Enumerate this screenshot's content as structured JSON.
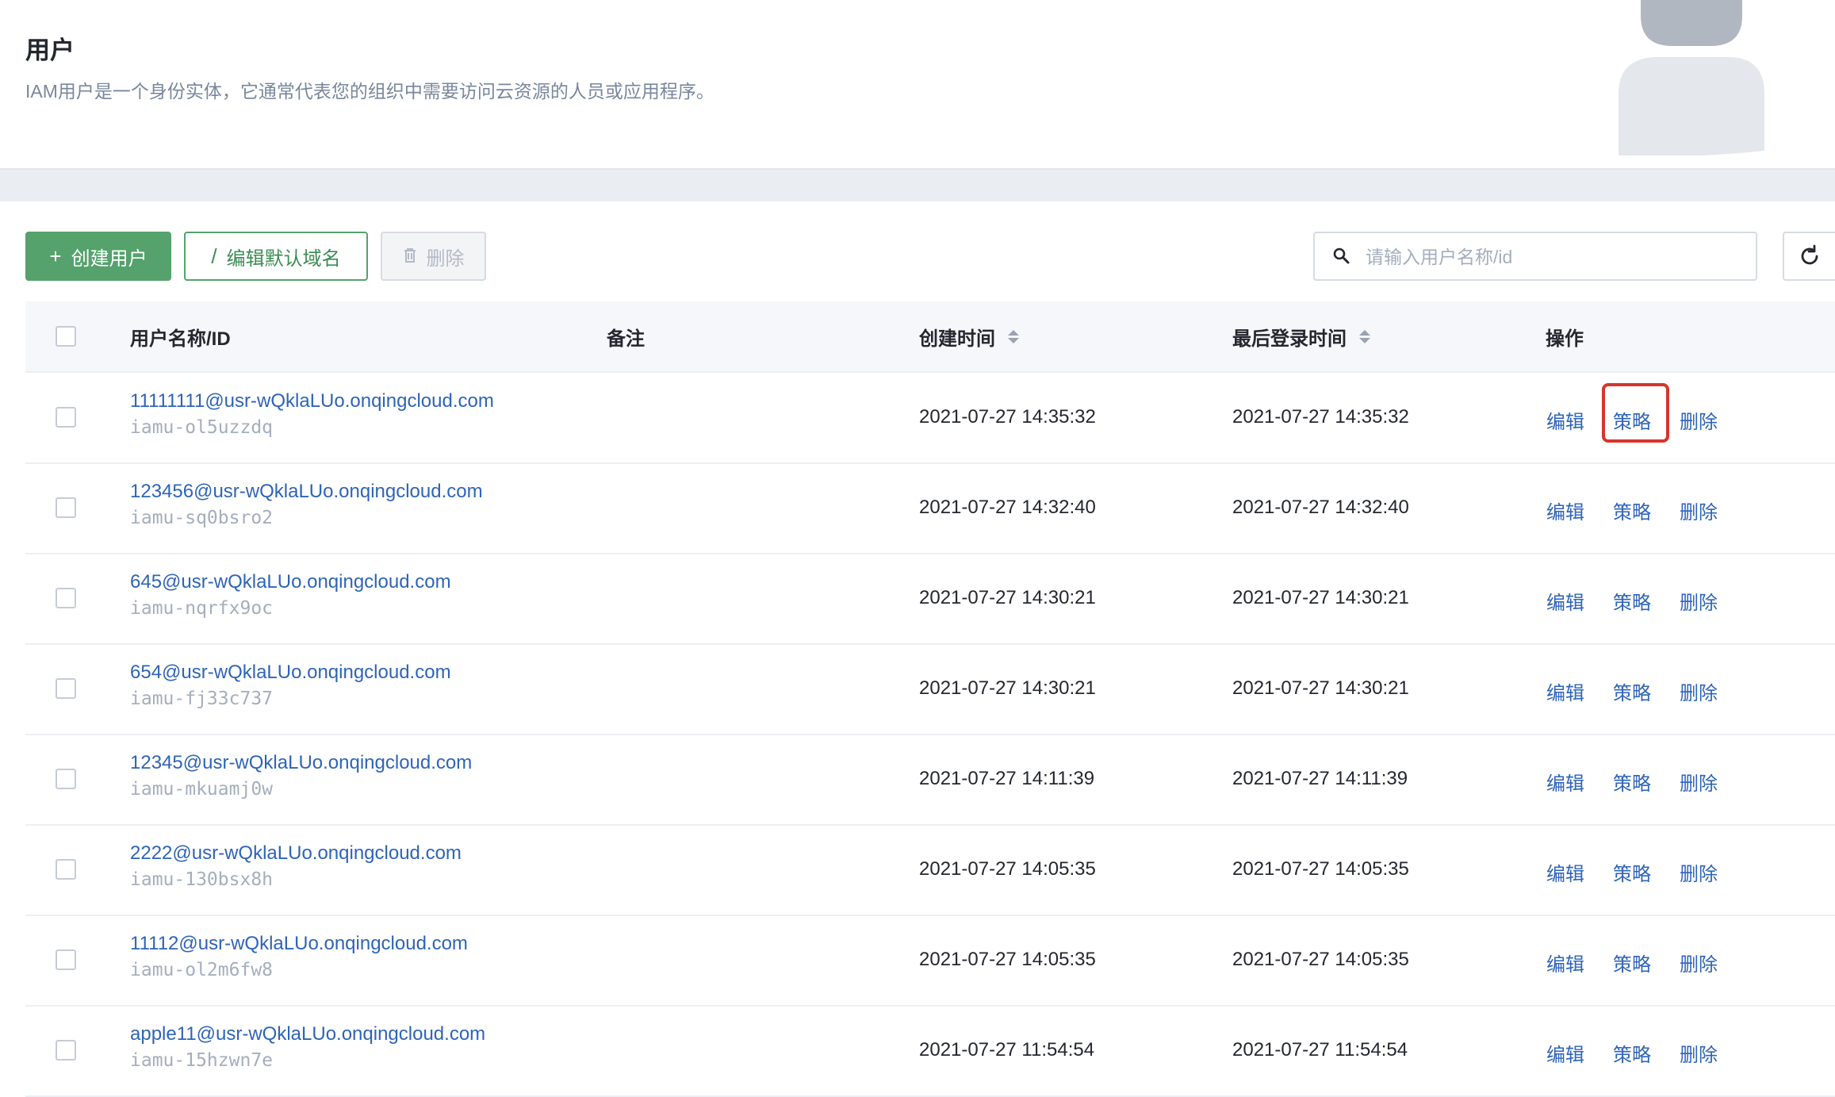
{
  "header": {
    "title": "用户",
    "description": "IAM用户是一个身份实体，它通常代表您的组织中需要访问云资源的人员或应用程序。"
  },
  "toolbar": {
    "create_label": "创建用户",
    "edit_domain_label": "编辑默认域名",
    "delete_label": "删除",
    "search_placeholder": "请输入用户名称/id"
  },
  "table": {
    "columns": {
      "name": "用户名称/ID",
      "remark": "备注",
      "created": "创建时间",
      "last_login": "最后登录时间",
      "actions": "操作"
    },
    "rows": [
      {
        "name": "11111111@usr-wQklaLUo.onqingcloud.com",
        "id": "iamu-ol5uzzdq",
        "created": "2021-07-27 14:35:32",
        "last_login": "2021-07-27 14:35:32",
        "edit": "编辑",
        "policy": "策略",
        "delete": "删除"
      },
      {
        "name": "123456@usr-wQklaLUo.onqingcloud.com",
        "id": "iamu-sq0bsro2",
        "created": "2021-07-27 14:32:40",
        "last_login": "2021-07-27 14:32:40",
        "edit": "编辑",
        "policy": "策略",
        "delete": "删除"
      },
      {
        "name": "645@usr-wQklaLUo.onqingcloud.com",
        "id": "iamu-nqrfx9oc",
        "created": "2021-07-27 14:30:21",
        "last_login": "2021-07-27 14:30:21",
        "edit": "编辑",
        "policy": "策略",
        "delete": "删除"
      },
      {
        "name": "654@usr-wQklaLUo.onqingcloud.com",
        "id": "iamu-fj33c737",
        "created": "2021-07-27 14:30:21",
        "last_login": "2021-07-27 14:30:21",
        "edit": "编辑",
        "policy": "策略",
        "delete": "删除"
      },
      {
        "name": "12345@usr-wQklaLUo.onqingcloud.com",
        "id": "iamu-mkuamj0w",
        "created": "2021-07-27 14:11:39",
        "last_login": "2021-07-27 14:11:39",
        "edit": "编辑",
        "policy": "策略",
        "delete": "删除"
      },
      {
        "name": "2222@usr-wQklaLUo.onqingcloud.com",
        "id": "iamu-130bsx8h",
        "created": "2021-07-27 14:05:35",
        "last_login": "2021-07-27 14:05:35",
        "edit": "编辑",
        "policy": "策略",
        "delete": "删除"
      },
      {
        "name": "11112@usr-wQklaLUo.onqingcloud.com",
        "id": "iamu-ol2m6fw8",
        "created": "2021-07-27 14:05:35",
        "last_login": "2021-07-27 14:05:35",
        "edit": "编辑",
        "policy": "策略",
        "delete": "删除"
      },
      {
        "name": "apple11@usr-wQklaLUo.onqingcloud.com",
        "id": "iamu-15hzwn7e",
        "created": "2021-07-27 11:54:54",
        "last_login": "2021-07-27 11:54:54",
        "edit": "编辑",
        "policy": "策略",
        "delete": "删除"
      }
    ]
  },
  "colors": {
    "primary": "#55a26c",
    "link": "#2e64b8",
    "highlight": "#d6352a"
  }
}
